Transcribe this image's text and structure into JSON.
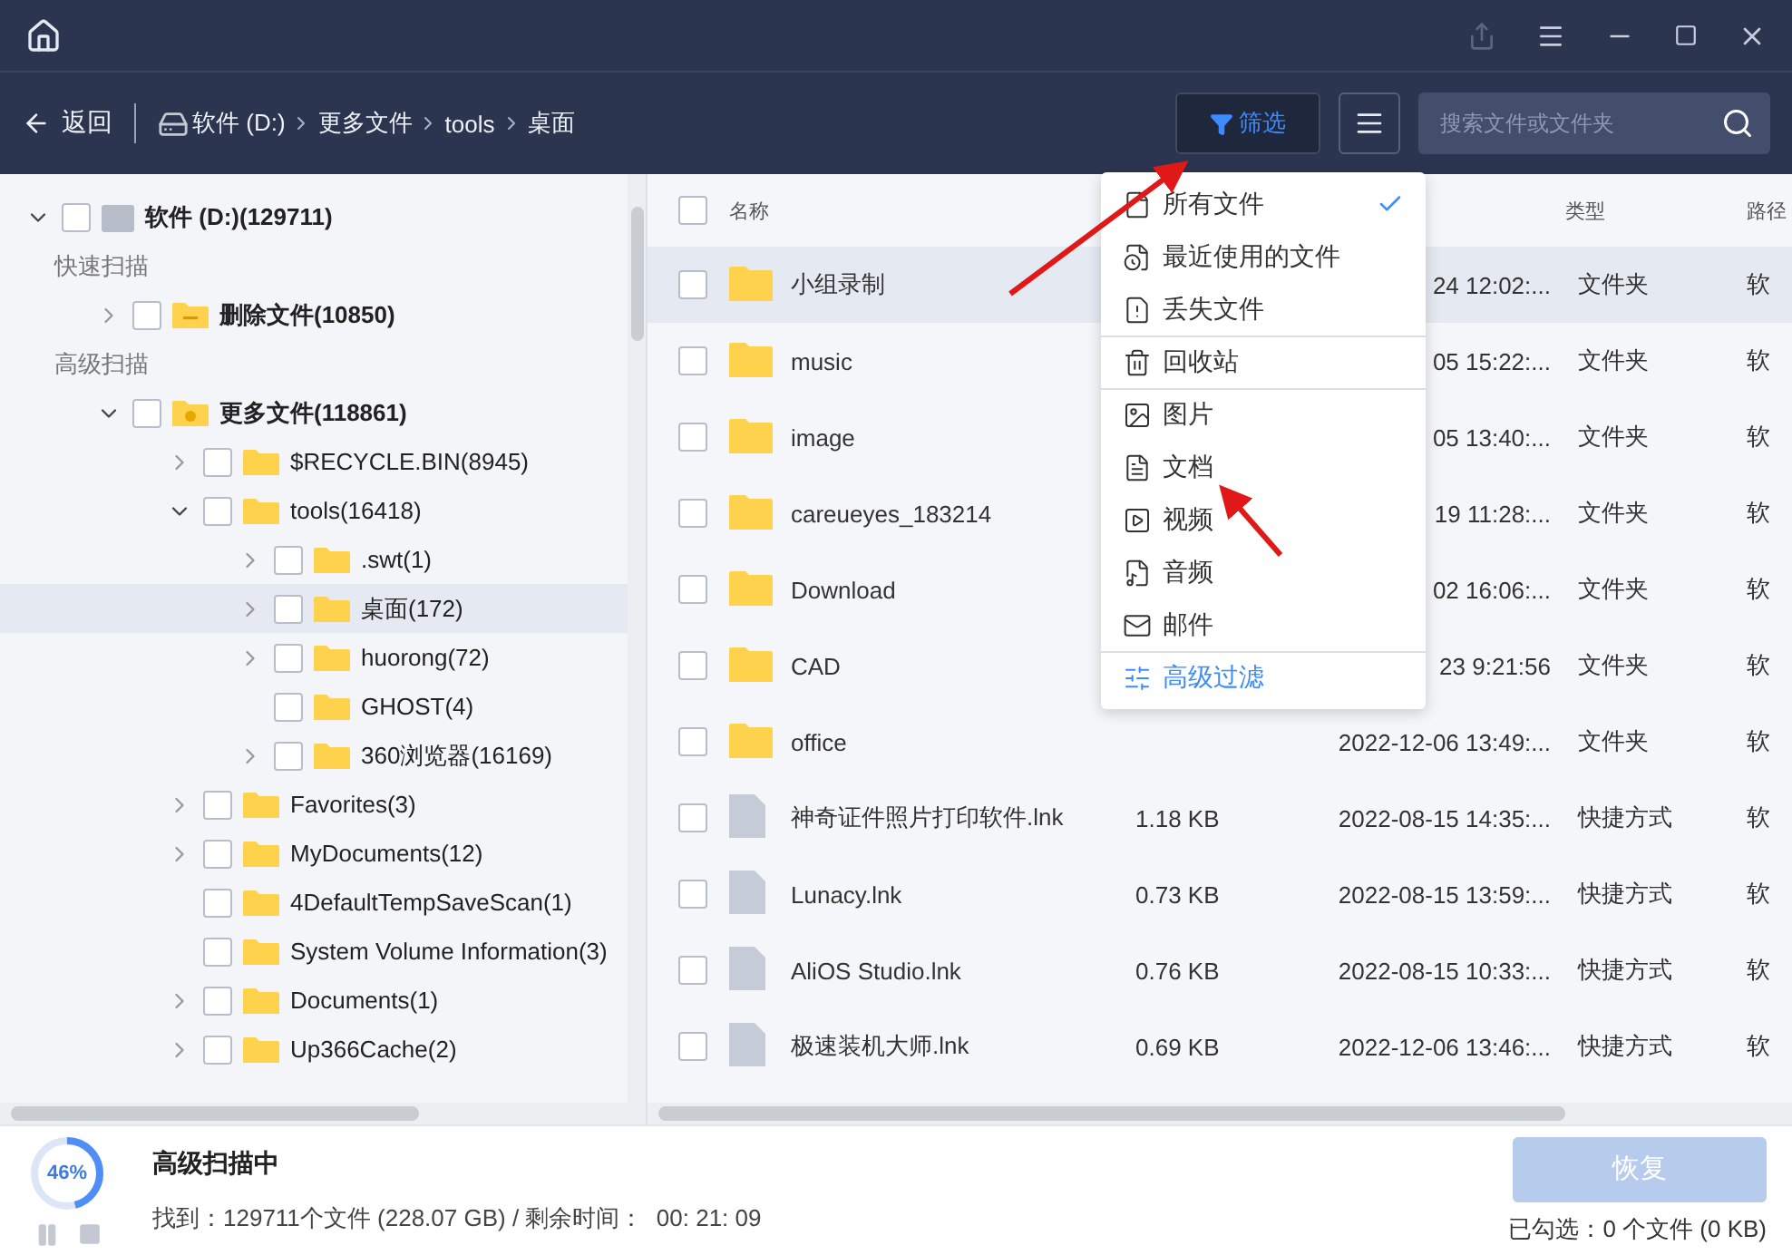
{
  "toolbar": {
    "back": "返回",
    "breadcrumb": [
      "软件 (D:)",
      "更多文件",
      "tools",
      "桌面"
    ],
    "filter": {
      "label": "筛选",
      "active": true
    },
    "search": {
      "placeholder": "搜索文件或文件夹"
    }
  },
  "tree": [
    {
      "label": "软件 (D:)(129711)",
      "kind": "drive",
      "expandable": true,
      "expanded": true,
      "checked": false,
      "selected": false,
      "children": [
        {
          "label": "快速扫描",
          "kind": "section"
        },
        {
          "label": "删除文件(10850)",
          "kind": "deleted",
          "expandable": true,
          "expanded": false,
          "checked": false,
          "selected": false
        },
        {
          "label": "高级扫描",
          "kind": "section"
        },
        {
          "label": "更多文件(118861)",
          "kind": "more",
          "expandable": true,
          "expanded": true,
          "checked": false,
          "selected": false,
          "children": [
            {
              "label": "$RECYCLE.BIN(8945)",
              "kind": "folder",
              "expandable": true,
              "expanded": false,
              "checked": false,
              "selected": false
            },
            {
              "label": "tools(16418)",
              "kind": "folder",
              "expandable": true,
              "expanded": true,
              "checked": false,
              "selected": false,
              "children": [
                {
                  "label": ".swt(1)",
                  "kind": "folder",
                  "expandable": true,
                  "expanded": false,
                  "checked": false,
                  "selected": false
                },
                {
                  "label": "桌面(172)",
                  "kind": "folder",
                  "expandable": true,
                  "expanded": false,
                  "checked": false,
                  "selected": true
                },
                {
                  "label": "huorong(72)",
                  "kind": "folder",
                  "expandable": true,
                  "expanded": false,
                  "checked": false,
                  "selected": false
                },
                {
                  "label": "GHOST(4)",
                  "kind": "folder",
                  "expandable": false,
                  "checked": false,
                  "selected": false
                },
                {
                  "label": "360浏览器(16169)",
                  "kind": "folder",
                  "expandable": true,
                  "expanded": false,
                  "checked": false,
                  "selected": false
                }
              ]
            },
            {
              "label": "Favorites(3)",
              "kind": "folder",
              "expandable": true,
              "expanded": false,
              "checked": false,
              "selected": false
            },
            {
              "label": "MyDocuments(12)",
              "kind": "folder",
              "expandable": true,
              "expanded": false,
              "checked": false,
              "selected": false
            },
            {
              "label": "4DefaultTempSaveScan(1)",
              "kind": "folder",
              "expandable": false,
              "checked": false,
              "selected": false
            },
            {
              "label": "System Volume Information(3)",
              "kind": "folder",
              "expandable": false,
              "checked": false,
              "selected": false
            },
            {
              "label": "Documents(1)",
              "kind": "folder",
              "expandable": true,
              "expanded": false,
              "checked": false,
              "selected": false
            },
            {
              "label": "Up366Cache(2)",
              "kind": "folder",
              "expandable": true,
              "expanded": false,
              "checked": false,
              "selected": false
            }
          ]
        }
      ]
    }
  ],
  "table": {
    "header_checked": false,
    "columns": [
      "名称",
      "类型",
      "路径"
    ],
    "rows": [
      {
        "kind": "folder",
        "name": "小组录制",
        "size": "",
        "date": "24 12:02:...",
        "type": "文件夹",
        "path": "软",
        "checked": false,
        "selected": true
      },
      {
        "kind": "folder",
        "name": "music",
        "size": "",
        "date": "05 15:22:...",
        "type": "文件夹",
        "path": "软",
        "checked": false,
        "selected": false
      },
      {
        "kind": "folder",
        "name": "image",
        "size": "",
        "date": "05 13:40:...",
        "type": "文件夹",
        "path": "软",
        "checked": false,
        "selected": false
      },
      {
        "kind": "folder",
        "name": "careueyes_183214",
        "size": "",
        "date": "19 11:28:...",
        "type": "文件夹",
        "path": "软",
        "checked": false,
        "selected": false
      },
      {
        "kind": "folder",
        "name": "Download",
        "size": "",
        "date": "02 16:06:...",
        "type": "文件夹",
        "path": "软",
        "checked": false,
        "selected": false
      },
      {
        "kind": "folder",
        "name": "CAD",
        "size": "",
        "date": "23 9:21:56",
        "type": "文件夹",
        "path": "软",
        "checked": false,
        "selected": false
      },
      {
        "kind": "folder",
        "name": "office",
        "size": "",
        "date": "2022-12-06 13:49:...",
        "type": "文件夹",
        "path": "软",
        "checked": false,
        "selected": false
      },
      {
        "kind": "shortcut",
        "name": "神奇证件照片打印软件.lnk",
        "size": "1.18 KB",
        "date": "2022-08-15 14:35:...",
        "type": "快捷方式",
        "path": "软",
        "checked": false,
        "selected": false
      },
      {
        "kind": "shortcut",
        "name": "Lunacy.lnk",
        "size": "0.73 KB",
        "date": "2022-08-15 13:59:...",
        "type": "快捷方式",
        "path": "软",
        "checked": false,
        "selected": false
      },
      {
        "kind": "shortcut",
        "name": "AliOS Studio.lnk",
        "size": "0.76 KB",
        "date": "2022-08-15 10:33:...",
        "type": "快捷方式",
        "path": "软",
        "checked": false,
        "selected": false
      },
      {
        "kind": "shortcut",
        "name": "极速装机大师.lnk",
        "size": "0.69 KB",
        "date": "2022-12-06 13:46:...",
        "type": "快捷方式",
        "path": "软",
        "checked": false,
        "selected": false
      }
    ]
  },
  "filter_menu": [
    {
      "label": "所有文件",
      "kind": "filter",
      "selected": true,
      "divider_before": false
    },
    {
      "label": "最近使用的文件",
      "kind": "filter",
      "selected": false,
      "divider_before": false
    },
    {
      "label": "丢失文件",
      "kind": "filter",
      "selected": false,
      "divider_before": false
    },
    {
      "label": "回收站",
      "kind": "filter",
      "selected": false,
      "divider_before": true
    },
    {
      "label": "图片",
      "kind": "filter",
      "selected": false,
      "divider_before": true
    },
    {
      "label": "文档",
      "kind": "filter",
      "selected": false,
      "divider_before": false
    },
    {
      "label": "视频",
      "kind": "filter",
      "selected": false,
      "divider_before": false
    },
    {
      "label": "音频",
      "kind": "filter",
      "selected": false,
      "divider_before": false
    },
    {
      "label": "邮件",
      "kind": "filter",
      "selected": false,
      "divider_before": false
    },
    {
      "label": "高级过滤",
      "kind": "action",
      "selected": false,
      "divider_before": true
    }
  ],
  "status": {
    "progress": {
      "level": 0.46,
      "reading": "46%"
    },
    "title": "高级扫描中",
    "summary": "找到：129711个文件 (228.07 GB) / 剩余时间：  00: 21: 09",
    "recover": {
      "label": "恢复",
      "disabled": true
    },
    "selection": "已勾选：0 个文件 (0 KB)"
  }
}
